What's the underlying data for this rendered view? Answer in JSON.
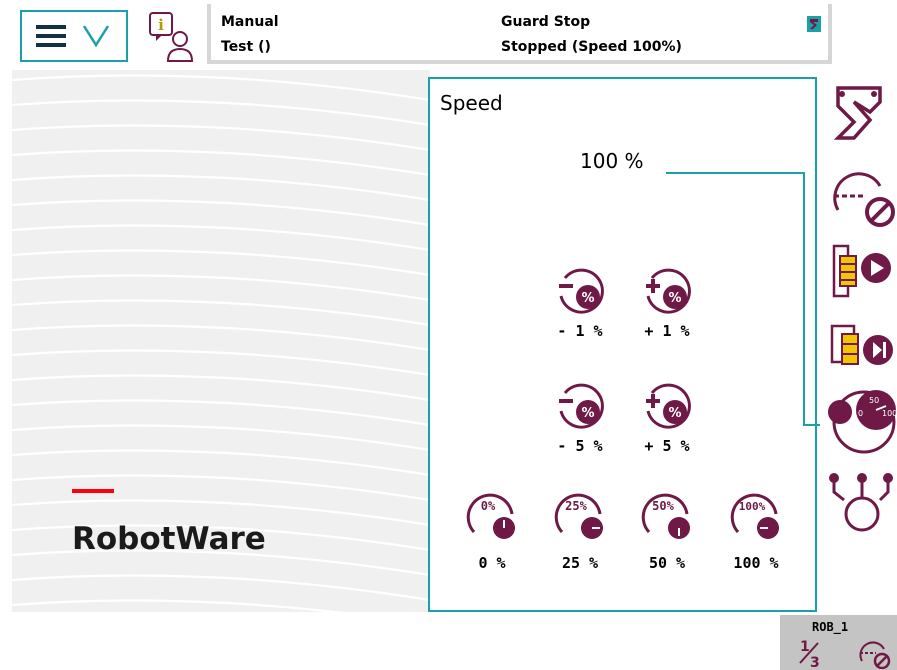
{
  "header": {
    "menu_icon": "hamburger-chevron-icon",
    "info_icon": "operator-info-icon",
    "status": {
      "mode": "Manual",
      "program": "Test ()",
      "guard": "Guard Stop",
      "state": "Stopped (Speed 100%)",
      "quickset_icon": "robot-quickset-icon"
    }
  },
  "brand": {
    "name": "RobotWare",
    "accent_color": "#ff000f"
  },
  "speed_panel": {
    "title": "Speed",
    "value": "100 %",
    "buttons": [
      {
        "label": "- 1 %",
        "icon": "speed-minus-icon"
      },
      {
        "label": "+ 1 %",
        "icon": "speed-plus-icon"
      },
      {
        "label": "- 5 %",
        "icon": "speed-minus-icon"
      },
      {
        "label": "+ 5 %",
        "icon": "speed-plus-icon"
      }
    ],
    "presets": [
      {
        "label": "0 %",
        "icon_text": "0%"
      },
      {
        "label": "25 %",
        "icon_text": "25%"
      },
      {
        "label": "50 %",
        "icon_text": "50%"
      },
      {
        "label": "100 %",
        "icon_text": "100%"
      }
    ]
  },
  "toolbar": {
    "items": [
      {
        "icon": "mechanical-unit-icon"
      },
      {
        "icon": "increment-icon"
      },
      {
        "icon": "run-mode-icon"
      },
      {
        "icon": "step-mode-icon"
      },
      {
        "icon": "speed-icon",
        "dial_labels": [
          "0",
          "50",
          "100"
        ]
      },
      {
        "icon": "tasks-icon"
      }
    ]
  },
  "footer": {
    "rob_label": "ROB_1",
    "fraction": "1/3"
  },
  "colors": {
    "accent": "#1aa1a8",
    "icon": "#6e1946",
    "bar_grey": "#d6d6d6"
  }
}
